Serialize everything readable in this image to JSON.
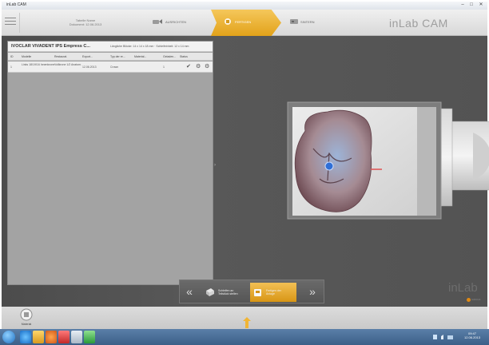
{
  "window": {
    "title": "inLab CAM",
    "min_glyph": "–",
    "max_glyph": "□",
    "close_glyph": "✕"
  },
  "header": {
    "project_line1": "Tabelle Name",
    "project_line2": "Dokument: 12.06.2013",
    "steps": [
      {
        "label": "AUSRICHTEN",
        "icon": "align-icon",
        "state": "inactive"
      },
      {
        "label": "FERTIGEN",
        "icon": "manufacture-icon",
        "state": "active"
      },
      {
        "label": "SINTERN",
        "icon": "sinter-icon",
        "state": "inactive"
      }
    ],
    "logo": "inLab CAM",
    "accent_color": "#e8a51f"
  },
  "job_panel": {
    "title": "IVOCLAR VIVADENT IPS Empress C...",
    "dimensions": "Längliche Blöcke: 14 x 14 x 18 mm · Schleifeinheit: 12 x 14 mm",
    "columns": [
      "ID",
      "Modelle",
      "Restaurat.",
      "Export...",
      "Typ der re...",
      "Material...",
      "Geladen...",
      "Status"
    ],
    "rows": [
      {
        "id": "1",
        "model": "Links 18/19/16 Innenkrone",
        "restoration": "Vollkrone 1/2 Anatom.",
        "export": "12.06.2013",
        "type": "Crown",
        "material": "",
        "loaded": "1",
        "status_icons": [
          "check-icon",
          "settings-icon",
          "gear-icon"
        ]
      }
    ]
  },
  "bottom_nav": {
    "prev_glyph": "«",
    "next_glyph": "»",
    "items": [
      {
        "label": "Schleifen an Teilstück stellen",
        "icon": "block-icon",
        "state": "inactive"
      },
      {
        "label": "Fertigen der Anlage",
        "icon": "machine-icon",
        "state": "active"
      }
    ]
  },
  "watermark": {
    "logo": "inLab",
    "sub": "SIRONA"
  },
  "material_button": {
    "label": "Material"
  },
  "taskbar": {
    "clock_time": "09:47",
    "clock_date": "12.06.2013"
  }
}
